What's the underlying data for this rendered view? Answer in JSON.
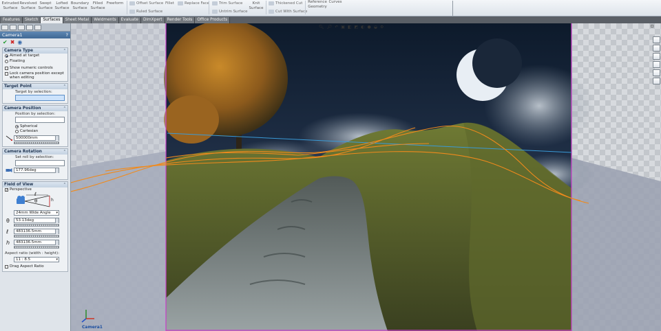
{
  "ribbon": {
    "buttons": [
      {
        "label": "Extruded Surface"
      },
      {
        "label": "Revolved Surface"
      },
      {
        "label": "Swept Surface"
      },
      {
        "label": "Lofted Surface"
      },
      {
        "label": "Boundary Surface"
      },
      {
        "label": "Filled Surface"
      },
      {
        "label": "Freeform"
      }
    ],
    "col2": [
      "Offset Surface",
      "Ruled Surface"
    ],
    "fillet": "Fillet",
    "replace_face": "Replace Face",
    "col3": [
      "Trim Surface",
      "Untrim Surface"
    ],
    "knit": "Knit Surface",
    "col4": [
      "Thickened Cut",
      "Cut With Surface"
    ],
    "reference_geometry": "Reference Geometry",
    "curves": "Curves"
  },
  "tabs": [
    "Features",
    "Sketch",
    "Surfaces",
    "Sheet Metal",
    "Weldments",
    "Evaluate",
    "DimXpert",
    "Render Tools",
    "Office Products"
  ],
  "active_tab": "Surfaces",
  "property_manager": {
    "title": "Camera1",
    "help": "?",
    "camera_type": {
      "heading": "Camera Type",
      "options": [
        "Aimed at target",
        "Floating"
      ],
      "show_numeric": "Show numeric controls",
      "lock_position": "Lock camera position except when editing"
    },
    "target_point": {
      "heading": "Target Point",
      "label": "Target by selection:"
    },
    "camera_position": {
      "heading": "Camera Position",
      "label": "Position by selection:",
      "options": [
        "Spherical",
        "Cartesian"
      ],
      "distance": "500000mm"
    },
    "camera_rotation": {
      "heading": "Camera Rotation",
      "label": "Set roll by selection:",
      "roll": "177.96deg"
    },
    "field_of_view": {
      "heading": "Field of View",
      "perspective": "Perspective",
      "lens": "24mm Wide Angle",
      "angle": "53.13deg",
      "distance": "483136.5mm",
      "height": "483136.5mm",
      "aspect_label": "Aspect ratio (width : height):",
      "aspect": "11 : 8.5",
      "drag_aspect": "Drag Aspect Ratio",
      "symbols": {
        "theta": "θ",
        "ell": "ℓ",
        "h": "h"
      }
    }
  },
  "viewport": {
    "triad_label": "Camera1"
  },
  "colors": {
    "accent": "#3f6894",
    "frame": "#c83cc8",
    "curve": "#f08a1c"
  }
}
